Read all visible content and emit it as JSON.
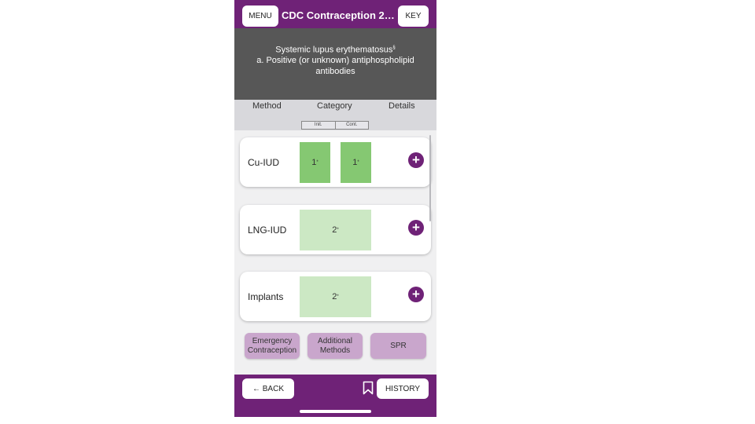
{
  "header": {
    "menu_label": "MENU",
    "title": "CDC Contraception 20...",
    "key_label": "KEY"
  },
  "condition": {
    "title": "Systemic lupus erythematosus",
    "title_mark": "§",
    "subtitle": "a.  Positive (or unknown) antiphospholipid antibodies"
  },
  "columns": {
    "method": "Method",
    "category": "Category",
    "details": "Details",
    "initiation": "Init.",
    "continuation": "Cont."
  },
  "methods": [
    {
      "name": "Cu-IUD",
      "init": "1",
      "init_mark": "*",
      "cont": "1",
      "cont_mark": "*"
    },
    {
      "name": "LNG-IUD",
      "value": "2",
      "mark": "*"
    },
    {
      "name": "Implants",
      "value": "2",
      "mark": "*"
    }
  ],
  "buttons": {
    "emergency": "Emergency Contraception",
    "additional": "Additional Methods",
    "spr": "SPR"
  },
  "footer": {
    "back_label": "← BACK",
    "history_label": "HISTORY"
  },
  "colors": {
    "brand_purple": "#6f2277",
    "category_1": "#85c872",
    "category_2": "#cce8c4",
    "lavender": "#c9a6cc"
  },
  "icons": [
    "plus-icon",
    "bookmark-icon",
    "back-arrow-icon"
  ]
}
